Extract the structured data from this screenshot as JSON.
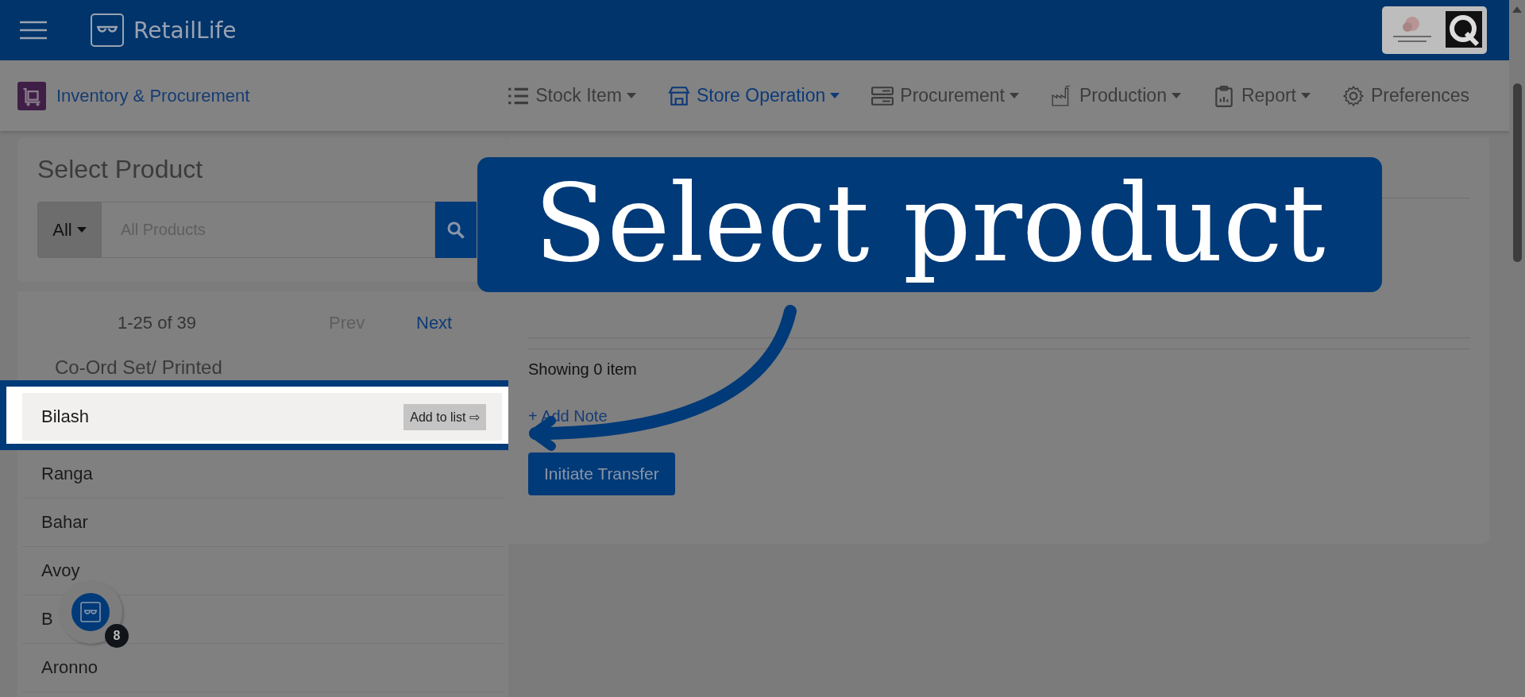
{
  "header": {
    "app_name": "RetailLife"
  },
  "module": {
    "title": "Inventory & Procurement"
  },
  "nav": [
    {
      "label": "Stock Item",
      "selected": false,
      "dropdown": true
    },
    {
      "label": "Store Operation",
      "selected": true,
      "dropdown": true
    },
    {
      "label": "Procurement",
      "selected": false,
      "dropdown": true
    },
    {
      "label": "Production",
      "selected": false,
      "dropdown": true
    },
    {
      "label": "Report",
      "selected": false,
      "dropdown": true
    },
    {
      "label": "Preferences",
      "selected": false,
      "dropdown": false
    }
  ],
  "product_search": {
    "title": "Select Product",
    "filter": "All",
    "placeholder": "All Products"
  },
  "pager": {
    "range": "1-25 of 39",
    "prev": {
      "label": "Prev",
      "disabled": true
    },
    "next": {
      "label": "Next",
      "disabled": false
    }
  },
  "category": "Co-Ord Set/ Printed",
  "products": [
    {
      "name": "Bilash",
      "highlighted": true,
      "action": "Add to list ⇨"
    },
    {
      "name": "Ranga",
      "highlighted": false
    },
    {
      "name": "Bahar",
      "highlighted": false
    },
    {
      "name": "Avoy",
      "highlighted": false
    },
    {
      "name": "B",
      "highlighted": false
    },
    {
      "name": "Aronno",
      "highlighted": false
    }
  ],
  "transfer": {
    "summary": "Showing 0 item",
    "add_note": "+ Add Note",
    "button": "Initiate Transfer"
  },
  "help_badge": {
    "count": "8"
  },
  "callout": {
    "text": "Select product"
  }
}
